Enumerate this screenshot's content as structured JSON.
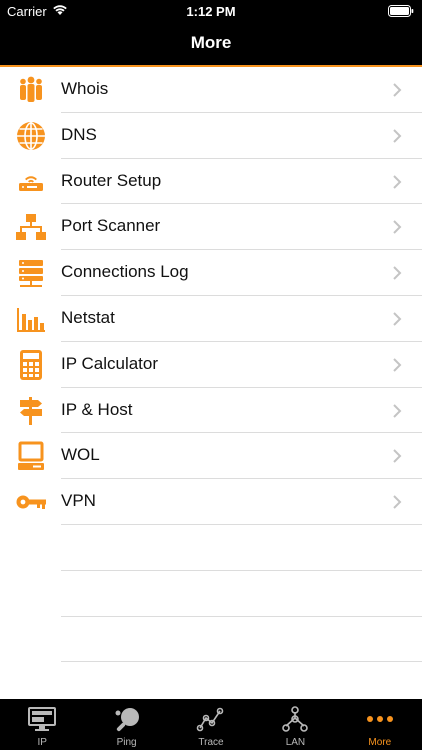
{
  "status_bar": {
    "carrier": "Carrier",
    "time": "1:12 PM"
  },
  "nav": {
    "title": "More"
  },
  "colors": {
    "accent": "#f7931e",
    "bar_bg": "#000000",
    "inactive": "#b9b9b9"
  },
  "menu": [
    {
      "label": "Whois",
      "icon": "people-icon"
    },
    {
      "label": "DNS",
      "icon": "globe-icon"
    },
    {
      "label": "Router Setup",
      "icon": "router-icon"
    },
    {
      "label": "Port Scanner",
      "icon": "network-tree-icon"
    },
    {
      "label": "Connections Log",
      "icon": "server-icon"
    },
    {
      "label": "Netstat",
      "icon": "bar-chart-icon"
    },
    {
      "label": "IP Calculator",
      "icon": "calculator-icon"
    },
    {
      "label": "IP & Host",
      "icon": "signpost-icon"
    },
    {
      "label": "WOL",
      "icon": "computer-icon"
    },
    {
      "label": "VPN",
      "icon": "key-icon"
    }
  ],
  "tabs": [
    {
      "label": "IP",
      "icon": "monitor-icon"
    },
    {
      "label": "Ping",
      "icon": "ping-pong-icon"
    },
    {
      "label": "Trace",
      "icon": "trace-graph-icon"
    },
    {
      "label": "LAN",
      "icon": "lan-icon"
    },
    {
      "label": "More",
      "icon": "more-dots-icon",
      "active": true
    }
  ]
}
